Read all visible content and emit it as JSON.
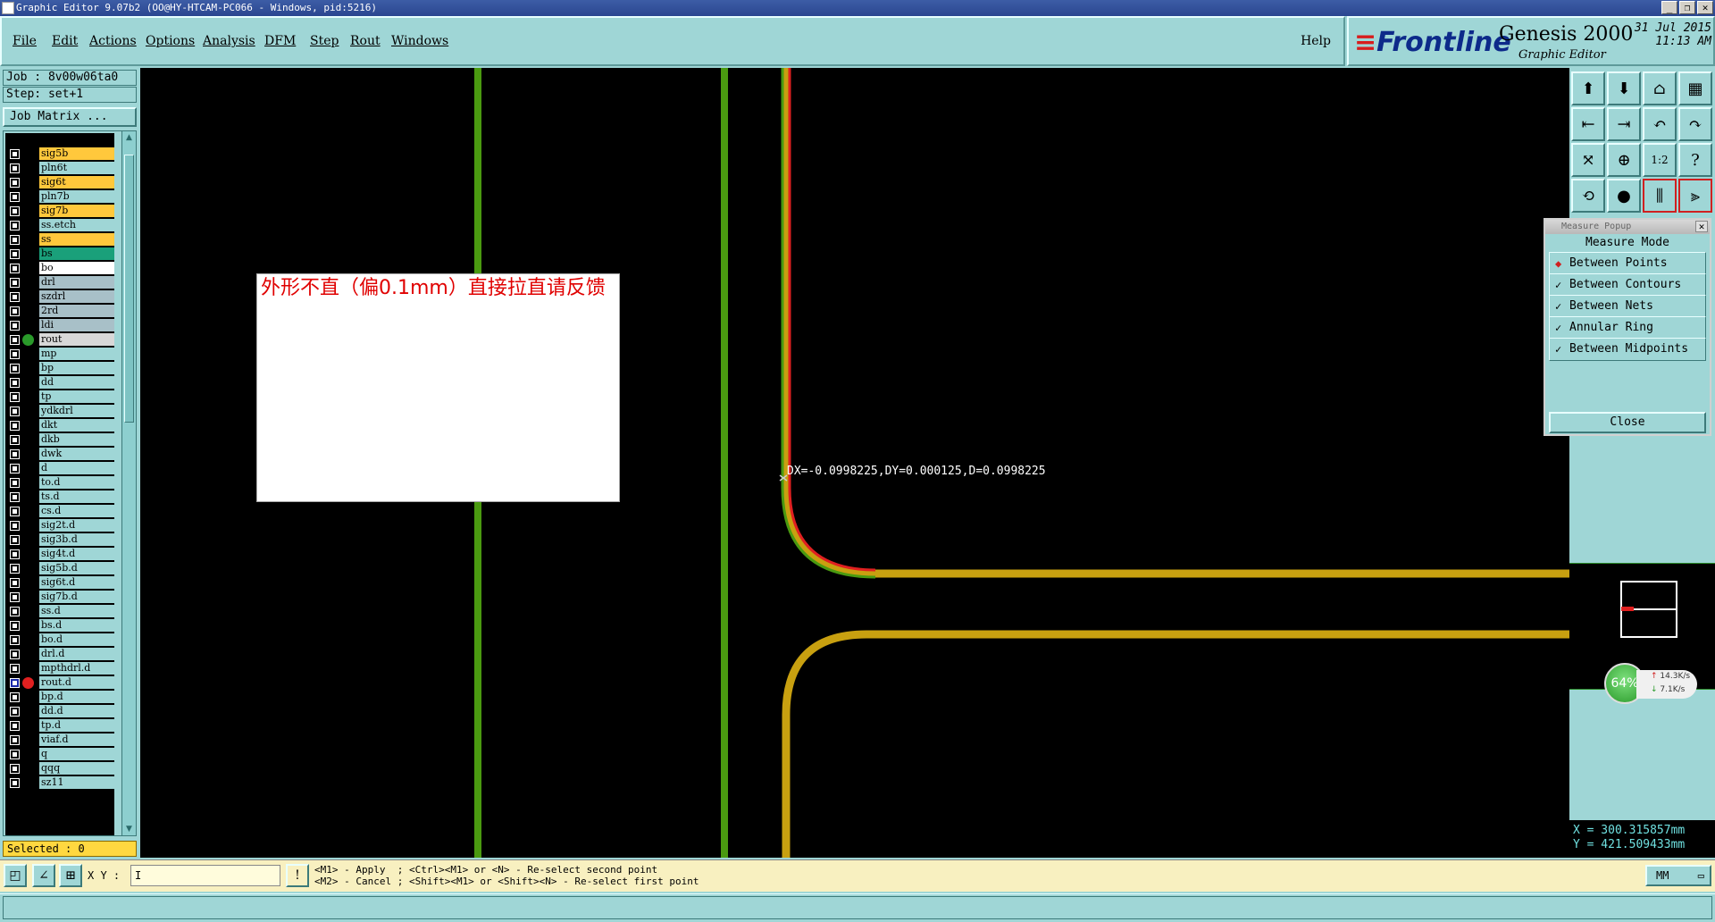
{
  "window": {
    "title": "Graphic Editor 9.07b2 (OO@HY-HTCAM-PC066 - Windows, pid:5216)"
  },
  "menu": [
    "File",
    "Edit",
    "Actions",
    "Options",
    "Analysis",
    "DFM",
    "Step",
    "Rout",
    "Windows"
  ],
  "help_label": "Help",
  "brand": {
    "logo": "Frontline",
    "product": "Genesis 2000",
    "subtitle": "Graphic Editor",
    "date": "31 Jul 2015",
    "time": "11:13 AM"
  },
  "job": {
    "job_line": "Job : 8v00w06ta0",
    "step_line": "Step: set+1",
    "matrix_button": "Job Matrix ..."
  },
  "layers": [
    {
      "name": "sig5b",
      "color": "#ffc83c",
      "dot": ""
    },
    {
      "name": "pln6t",
      "color": "#9fd6d6",
      "dot": ""
    },
    {
      "name": "sig6t",
      "color": "#ffc83c",
      "dot": ""
    },
    {
      "name": "pln7b",
      "color": "#9fd6d6",
      "dot": ""
    },
    {
      "name": "sig7b",
      "color": "#ffc83c",
      "dot": ""
    },
    {
      "name": "ss.etch",
      "color": "#9fd6d6",
      "dot": ""
    },
    {
      "name": "ss",
      "color": "#ffc83c",
      "dot": ""
    },
    {
      "name": "bs",
      "color": "#1aa07a",
      "dot": ""
    },
    {
      "name": "bo",
      "color": "#ffffff",
      "dot": ""
    },
    {
      "name": "drl",
      "color": "#a8c0c8",
      "dot": ""
    },
    {
      "name": "szdrl",
      "color": "#a8c0c8",
      "dot": ""
    },
    {
      "name": "2rd",
      "color": "#a8c0c8",
      "dot": ""
    },
    {
      "name": "ldi",
      "color": "#a8c0c8",
      "dot": ""
    },
    {
      "name": "rout",
      "color": "#d8d8d8",
      "dot": "#2a9a2a"
    },
    {
      "name": "mp",
      "color": "#9fd6d6",
      "dot": ""
    },
    {
      "name": "bp",
      "color": "#9fd6d6",
      "dot": ""
    },
    {
      "name": "dd",
      "color": "#9fd6d6",
      "dot": ""
    },
    {
      "name": "tp",
      "color": "#9fd6d6",
      "dot": ""
    },
    {
      "name": "ydkdrl",
      "color": "#9fd6d6",
      "dot": ""
    },
    {
      "name": "dkt",
      "color": "#9fd6d6",
      "dot": ""
    },
    {
      "name": "dkb",
      "color": "#9fd6d6",
      "dot": ""
    },
    {
      "name": "dwk",
      "color": "#9fd6d6",
      "dot": ""
    },
    {
      "name": "d",
      "color": "#9fd6d6",
      "dot": ""
    },
    {
      "name": "to.d",
      "color": "#9fd6d6",
      "dot": ""
    },
    {
      "name": "ts.d",
      "color": "#9fd6d6",
      "dot": ""
    },
    {
      "name": "cs.d",
      "color": "#9fd6d6",
      "dot": ""
    },
    {
      "name": "sig2t.d",
      "color": "#9fd6d6",
      "dot": ""
    },
    {
      "name": "sig3b.d",
      "color": "#9fd6d6",
      "dot": ""
    },
    {
      "name": "sig4t.d",
      "color": "#9fd6d6",
      "dot": ""
    },
    {
      "name": "sig5b.d",
      "color": "#9fd6d6",
      "dot": ""
    },
    {
      "name": "sig6t.d",
      "color": "#9fd6d6",
      "dot": ""
    },
    {
      "name": "sig7b.d",
      "color": "#9fd6d6",
      "dot": ""
    },
    {
      "name": "ss.d",
      "color": "#9fd6d6",
      "dot": ""
    },
    {
      "name": "bs.d",
      "color": "#9fd6d6",
      "dot": ""
    },
    {
      "name": "bo.d",
      "color": "#9fd6d6",
      "dot": ""
    },
    {
      "name": "drl.d",
      "color": "#9fd6d6",
      "dot": ""
    },
    {
      "name": "mpthdrl.d",
      "color": "#9fd6d6",
      "dot": ""
    },
    {
      "name": "rout.d",
      "color": "#9fd6d6",
      "dot": "#e02020"
    },
    {
      "name": "bp.d",
      "color": "#9fd6d6",
      "dot": ""
    },
    {
      "name": "dd.d",
      "color": "#9fd6d6",
      "dot": ""
    },
    {
      "name": "tp.d",
      "color": "#9fd6d6",
      "dot": ""
    },
    {
      "name": "viaf.d",
      "color": "#9fd6d6",
      "dot": ""
    },
    {
      "name": "q",
      "color": "#9fd6d6",
      "dot": ""
    },
    {
      "name": "qqq",
      "color": "#9fd6d6",
      "dot": ""
    },
    {
      "name": "sz11",
      "color": "#9fd6d6",
      "dot": ""
    }
  ],
  "selected_label": "Selected : 0",
  "annotation_note": "外形不直（偏0.1mm）直接拉直请反馈",
  "measurement_readout": "DX=-0.0998225,DY=0.000125,D=0.0998225",
  "measure_popup": {
    "title": "Measure Popup",
    "header": "Measure Mode",
    "options": [
      "Between Points",
      "Between Contours",
      "Between Nets",
      "Annular Ring",
      "Between Midpoints"
    ],
    "selected": "Between Points",
    "close_label": "Close"
  },
  "tools": [
    "1:2",
    "?"
  ],
  "network_gauge": {
    "percent": "64%",
    "up": "14.3K/s",
    "down": "7.1K/s"
  },
  "cursor_coords": {
    "x": "X = 300.315857mm",
    "y": "Y = 421.509433mm"
  },
  "bottom": {
    "xy_label": "X Y :",
    "xy_value": "I",
    "hint_line1": "<M1> - Apply  ; <Ctrl><M1> or <N> - Re-select second point",
    "hint_line2": "<M2> - Cancel ; <Shift><M1> or <Shift><N> - Re-select first point",
    "units": "MM"
  },
  "colors": {
    "panel": "#9fd6d6",
    "canvas": "#000000",
    "trace_green": "#4a9a10",
    "trace_gold": "#c8a010"
  }
}
